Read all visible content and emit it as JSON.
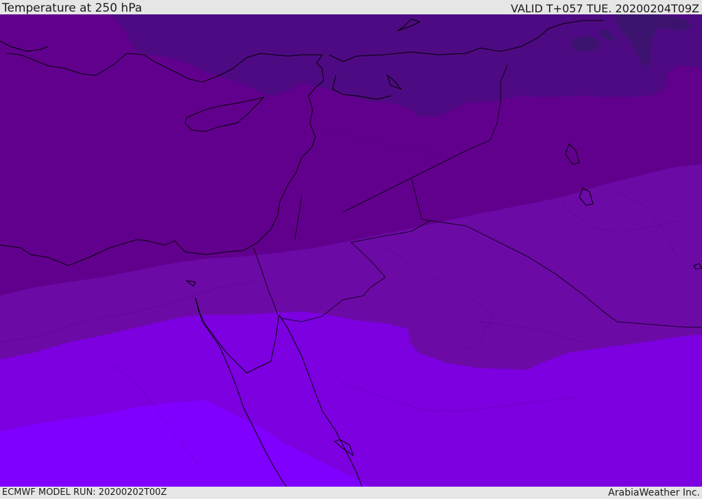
{
  "header": {
    "title": "Temperature at 250 hPa",
    "valid": "VALID T+057 TUE. 20200204T09Z"
  },
  "footer": {
    "model_run": "ECMWF MODEL RUN: 20200202T00Z",
    "credit": "ArabiaWeather Inc."
  },
  "map": {
    "field": "temperature",
    "level": "250 hPa",
    "colors": {
      "band_coldest": "#3c1470",
      "band_1": "#4e0a82",
      "band_2": "#62008e",
      "band_3": "#6c0aa6",
      "band_4": "#7c00e0",
      "band_warmest": "#8000ff",
      "coastline": "#000000"
    }
  }
}
